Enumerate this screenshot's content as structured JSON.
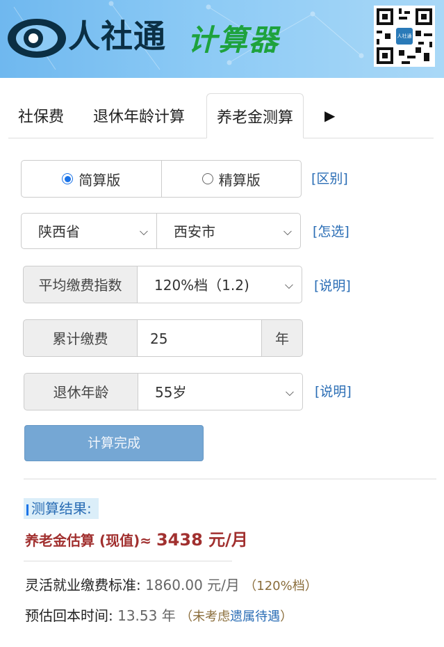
{
  "header": {
    "brand": "人社通",
    "subtitle": "计算器",
    "qr_label": "人社通"
  },
  "tabs": [
    {
      "label": "社保费"
    },
    {
      "label": "退休年龄计算"
    },
    {
      "label": "养老金测算",
      "active": true
    },
    {
      "label": "▶"
    }
  ],
  "mode": {
    "simple": "简算版",
    "precise": "精算版",
    "selected": "simple",
    "link": "[区别]"
  },
  "location": {
    "province": "陕西省",
    "city": "西安市",
    "link": "[怎选]"
  },
  "payment_index": {
    "label": "平均缴费指数",
    "value": "120%档（1.2)",
    "link": "[说明]"
  },
  "years": {
    "label": "累计缴费",
    "value": "25",
    "unit": "年"
  },
  "retire_age": {
    "label": "退休年龄",
    "value": "55岁",
    "link": "[说明]"
  },
  "calc_button": "计算完成",
  "result": {
    "title": "测算结果:",
    "estimate_label": "养老金估算 (现值)≈",
    "estimate_value": "3438 元/月",
    "flex_label": "灵活就业缴费标准:",
    "flex_value": "1860.00 元/月",
    "flex_note": "（120%档）",
    "payback_label": "预估回本时间:",
    "payback_value": "13.53 年",
    "payback_note_pre": "（未考虑",
    "payback_note_link": "遗属待遇",
    "payback_note_post": "）"
  },
  "colors": {
    "accent": "#2a6db5",
    "estimate": "#a1302f",
    "button": "#75a7d4"
  }
}
